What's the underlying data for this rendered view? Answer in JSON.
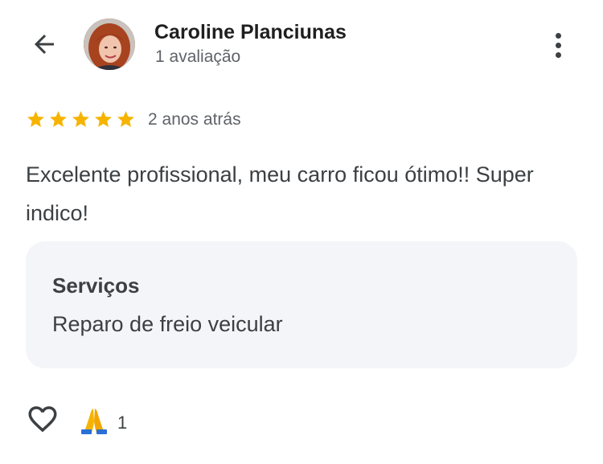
{
  "header": {
    "back_icon": "arrow-back-icon",
    "reviewer_name": "Caroline Planciunas",
    "review_count": "1 avaliação",
    "more_icon": "more-vert-icon"
  },
  "review": {
    "rating": 5,
    "rating_max": 5,
    "star_color": "#f6b400",
    "time_ago": "2 anos atrás",
    "text": "Excelente profissional, meu carro ficou ótimo!! Super indico!"
  },
  "services": {
    "title": "Serviços",
    "value": "Reparo de freio veicular"
  },
  "footer": {
    "like_icon": "heart-outline-icon",
    "reaction_icon": "folded-hands-icon",
    "reaction_count": "1"
  }
}
